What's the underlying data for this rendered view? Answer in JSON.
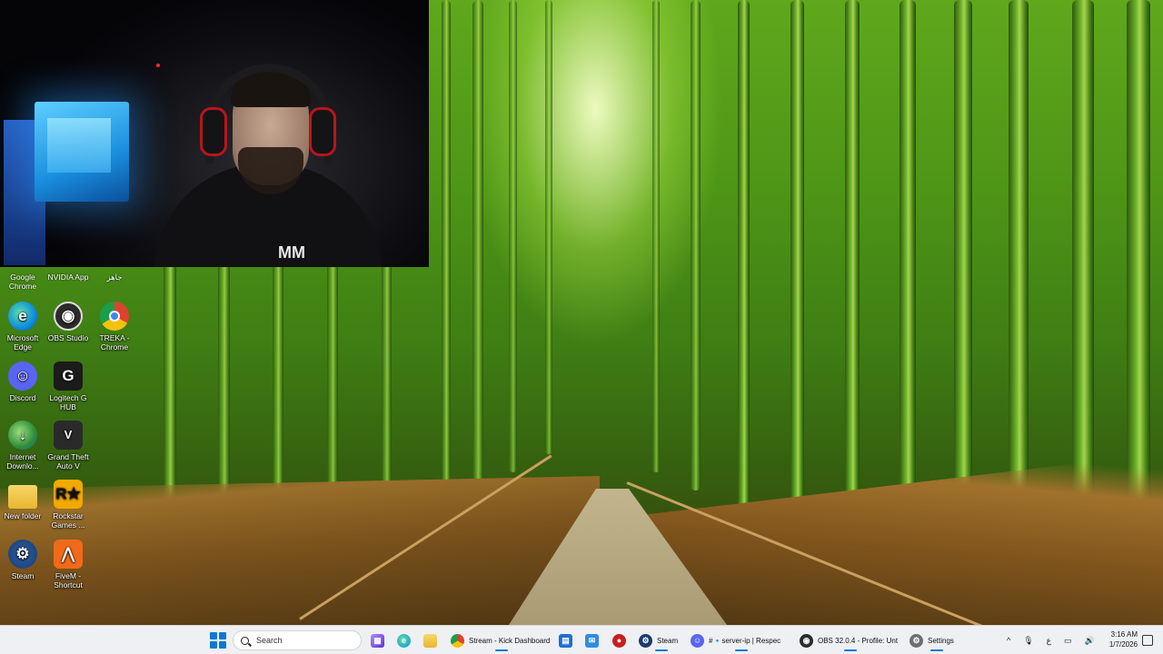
{
  "desktop": {
    "partial_labels": [
      "Google Chrome",
      "NVIDIA App",
      "جاهز"
    ],
    "icons": [
      {
        "label": "Microsoft Edge",
        "icon": "edge-icon",
        "color": "#0c8de0"
      },
      {
        "label": "OBS Studio",
        "icon": "obs-icon",
        "color": "#2b2b2b"
      },
      {
        "label": "TREKA - Chrome",
        "icon": "chrome-icon",
        "color": "#e04030"
      },
      {
        "label": "Discord",
        "icon": "discord-icon",
        "color": "#5865f2"
      },
      {
        "label": "Logitech G HUB",
        "icon": "logitech-icon",
        "color": "#1b1b1b"
      },
      {
        "label": "Internet Downlo...",
        "icon": "idm-icon",
        "color": "#3a8f3a"
      },
      {
        "label": "Grand Theft Auto V",
        "icon": "gta-icon",
        "color": "#2a2a2a"
      },
      {
        "label": "New folder",
        "icon": "folder-icon",
        "color": "#f3c84a"
      },
      {
        "label": "Rockstar Games ...",
        "icon": "rockstar-icon",
        "color": "#f2a900"
      },
      {
        "label": "Steam",
        "icon": "steam-icon",
        "color": "#1b3b6f"
      },
      {
        "label": "FiveM - Shortcut",
        "icon": "fivem-icon",
        "color": "#f06a1a"
      }
    ]
  },
  "webcam": {
    "logo_text": "MM"
  },
  "taskbar": {
    "search_placeholder": "Search",
    "apps": [
      {
        "label": "",
        "icon": "kick-app-icon",
        "color": "#7a3cff"
      },
      {
        "label": "",
        "icon": "edge-taskbar-icon",
        "color": "#0c8de0"
      },
      {
        "label": "",
        "icon": "file-explorer-icon",
        "color": "#f3c84a"
      },
      {
        "label": "Stream - Kick Dashboard",
        "icon": "chrome-taskbar-icon",
        "color": "#e04030"
      },
      {
        "label": "",
        "icon": "store-icon",
        "color": "#1f6fd0"
      },
      {
        "label": "",
        "icon": "outlook-icon",
        "color": "#2f8de0"
      },
      {
        "label": "",
        "icon": "record-icon",
        "color": "#c81e1e"
      },
      {
        "label": "Steam",
        "icon": "steam-taskbar-icon",
        "color": "#1b3b6f"
      },
      {
        "label": "#🔹server-ip | Respec",
        "icon": "discord-taskbar-icon",
        "color": "#5865f2"
      },
      {
        "label": "OBS 32.0.4 - Profile: Unt",
        "icon": "obs-taskbar-icon",
        "color": "#2b2b2b"
      },
      {
        "label": "Settings",
        "icon": "settings-icon",
        "color": "#6b6f78"
      }
    ],
    "tray": {
      "keyboard_layout": "ع",
      "time": "3:16 AM",
      "date": "1/7/2026"
    }
  }
}
